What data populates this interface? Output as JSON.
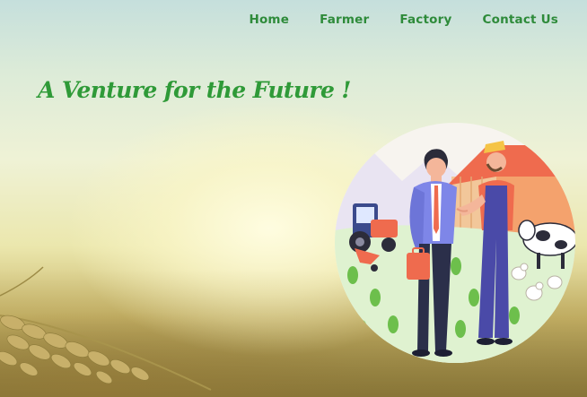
{
  "nav": {
    "items": [
      {
        "label": "Home"
      },
      {
        "label": "Farmer"
      },
      {
        "label": "Factory"
      },
      {
        "label": "Contact Us"
      }
    ]
  },
  "hero": {
    "tagline": "A Venture for the Future !",
    "illustration_icon": "farmer-businessman-handshake-illustration",
    "background_icon": "wheat-field-sunset-photo"
  },
  "colors": {
    "nav_text": "#2e8b3a",
    "tagline": "#2f9a38"
  }
}
